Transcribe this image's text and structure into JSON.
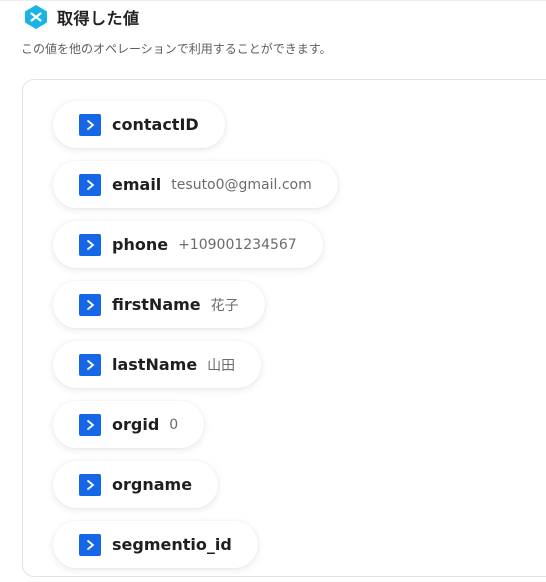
{
  "header": {
    "title": "取得した値",
    "logo_icon": "yoom-logo-icon",
    "logo_color": "#1bb3e6"
  },
  "description": "この値を他のオペレーションで利用することができます。",
  "accent_color": "#1667e8",
  "fields": [
    {
      "key": "contactID",
      "value": ""
    },
    {
      "key": "email",
      "value": "tesuto0@gmail.com"
    },
    {
      "key": "phone",
      "value": "+109001234567"
    },
    {
      "key": "firstName",
      "value": "花子"
    },
    {
      "key": "lastName",
      "value": "山田"
    },
    {
      "key": "orgid",
      "value": "0"
    },
    {
      "key": "orgname",
      "value": ""
    },
    {
      "key": "segmentio_id",
      "value": ""
    }
  ],
  "field_icon": "chevron-right-icon"
}
